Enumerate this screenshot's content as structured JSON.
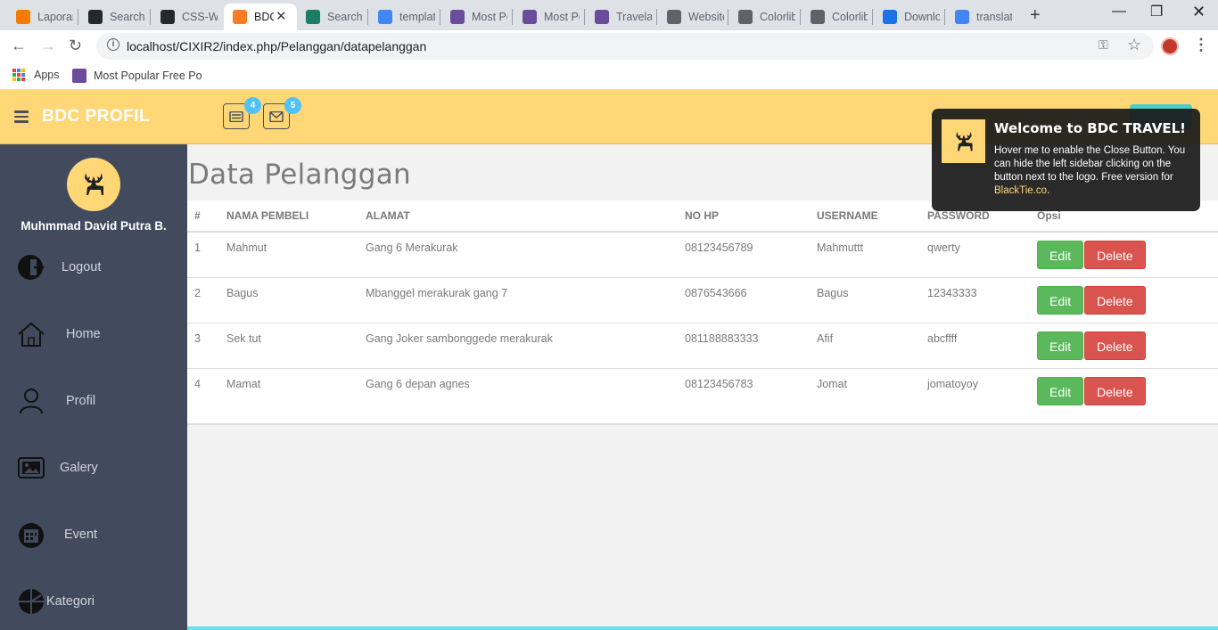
{
  "browser": {
    "tabs": [
      {
        "title": "Laporan",
        "icon": "blogger-icon",
        "color": "#f57c00"
      },
      {
        "title": "Search",
        "icon": "github-icon",
        "color": "#24292e"
      },
      {
        "title": "CSS-Wo",
        "icon": "github-icon",
        "color": "#24292e"
      },
      {
        "title": "BDC",
        "icon": "xampp-icon",
        "color": "#fb7a24"
      },
      {
        "title": "Search",
        "icon": "v-icon",
        "color": "#1a7f64"
      },
      {
        "title": "templat",
        "icon": "google-icon",
        "color": "#4285f4"
      },
      {
        "title": "Most Po",
        "icon": "colorlib-icon",
        "color": "#6b4b9b"
      },
      {
        "title": "Most Po",
        "icon": "colorlib-icon",
        "color": "#6b4b9b"
      },
      {
        "title": "Travelas",
        "icon": "colorlib-icon",
        "color": "#6b4b9b"
      },
      {
        "title": "Website",
        "icon": "page-icon",
        "color": "#5f6368"
      },
      {
        "title": "Colorlib",
        "icon": "wordpress-icon",
        "color": "#5f6368"
      },
      {
        "title": "Colorlib",
        "icon": "wordpress-icon",
        "color": "#5f6368"
      },
      {
        "title": "Downlo",
        "icon": "download-icon",
        "color": "#1a73e8"
      },
      {
        "title": "translat",
        "icon": "google-icon",
        "color": "#4285f4"
      }
    ],
    "url": "localhost/CIXIR2/index.php/Pelanggan/datapelanggan",
    "bookmarks": {
      "apps": "Apps",
      "item1": "Most Popular Free Po"
    }
  },
  "header": {
    "logo": "BDC PROFIL",
    "tasks_badge": "4",
    "mail_badge": "5"
  },
  "sidebar": {
    "user_name": "Muhmmad David Putra B.",
    "items": [
      {
        "label": "Logout"
      },
      {
        "label": "Home"
      },
      {
        "label": "Profil"
      },
      {
        "label": "Galery"
      },
      {
        "label": "Event"
      },
      {
        "label": "Kategori"
      }
    ]
  },
  "main": {
    "title": "Data Pelanggan",
    "columns": [
      "#",
      "NAMA PEMBELI",
      "ALAMAT",
      "NO HP",
      "USERNAME",
      "PASSWORD",
      "Opsi"
    ],
    "rows": [
      {
        "no": "1",
        "nama": "Mahmut",
        "alamat": "Gang 6 Merakurak",
        "hp": "08123456789",
        "username": "Mahmuttt",
        "password": "qwerty"
      },
      {
        "no": "2",
        "nama": "Bagus",
        "alamat": "Mbanggel merakurak gang 7",
        "hp": "0876543666",
        "username": "Bagus",
        "password": "12343333"
      },
      {
        "no": "3",
        "nama": "Sek tut",
        "alamat": "Gang Joker sambonggede merakurak",
        "hp": "081188883333",
        "username": "Afif",
        "password": "abcffff"
      },
      {
        "no": "4",
        "nama": "Mamat",
        "alamat": "Gang 6 depan agnes",
        "hp": "08123456783",
        "username": "Jomat",
        "password": "jomatoyoy"
      }
    ],
    "edit_label": "Edit",
    "delete_label": "Delete"
  },
  "notification": {
    "title": "Welcome to BDC TRAVEL!",
    "text": "Hover me to enable the Close Button. You can hide the left sidebar clicking on the button next to the logo. Free version for ",
    "link": "BlackTie.co",
    "suffix": "."
  },
  "colors": {
    "header_bg": "#ffd777",
    "sidebar_bg": "#424a5d",
    "edit_btn": "#5cb85c",
    "delete_btn": "#d9534f",
    "accent": "#68dff0"
  }
}
